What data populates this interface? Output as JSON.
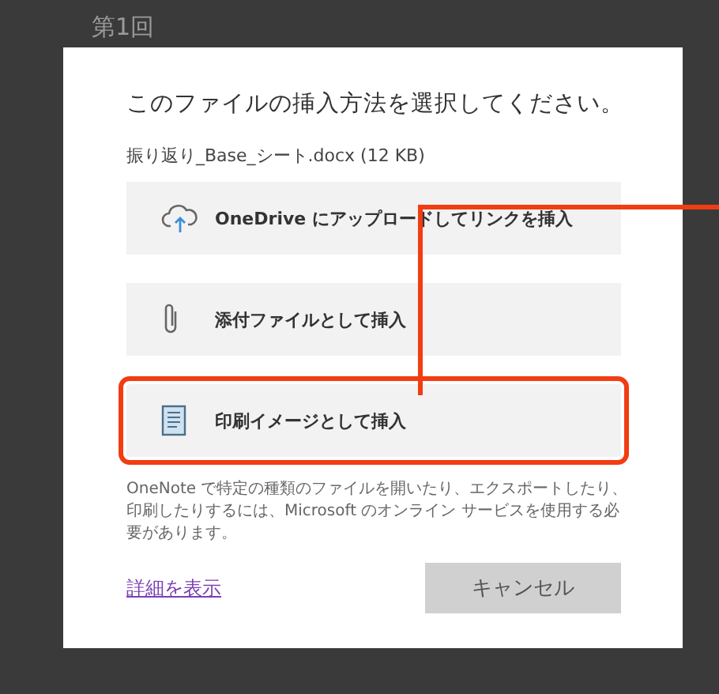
{
  "background_title": "第1回",
  "dialog": {
    "title": "このファイルの挿入方法を選択してください。",
    "file": "振り返り_Base_シート.docx (12 KB)",
    "options": [
      {
        "kind": "cloud",
        "label": "OneDrive にアップロードしてリンクを挿入",
        "highlighted": false
      },
      {
        "kind": "clip",
        "label": "添付ファイルとして挿入",
        "highlighted": false
      },
      {
        "kind": "page",
        "label": "印刷イメージとして挿入",
        "highlighted": true
      }
    ],
    "note": "OneNote で特定の種類のファイルを開いたり、エクスポートしたり、印刷したりするには、Microsoft のオンライン サービスを使用する必要があります。",
    "link": "詳細を表示",
    "cancel": "キャンセル"
  }
}
